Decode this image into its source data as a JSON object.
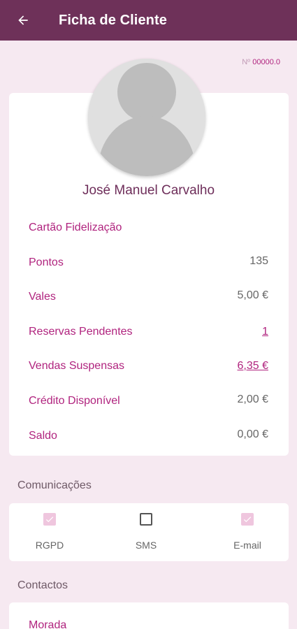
{
  "appbar": {
    "title": "Ficha de Cliente",
    "back_icon": "arrow-left-icon",
    "background": "#6e3159"
  },
  "client": {
    "number_prefix": "Nº",
    "number": "00000.0",
    "name": "José Manuel Carvalho",
    "avatar_icon": "person-placeholder-icon"
  },
  "info": {
    "loyalty_card_label": "Cartão Fidelização",
    "rows": [
      {
        "label": "Pontos",
        "value": "135"
      },
      {
        "label": "Vales",
        "value": "5,00 €"
      },
      {
        "label": "Reservas Pendentes",
        "value": "1"
      },
      {
        "label": "Vendas Suspensas",
        "value": "6,35 €"
      },
      {
        "label": "Crédito Disponível",
        "value": "2,00 €"
      },
      {
        "label": "Saldo",
        "value": "0,00 €"
      }
    ]
  },
  "communications": {
    "title": "Comunicações",
    "items": [
      {
        "label": "RGPD",
        "checked": true
      },
      {
        "label": "SMS",
        "checked": false
      },
      {
        "label": "E-mail",
        "checked": true
      }
    ]
  },
  "contacts": {
    "title": "Contactos",
    "address_label": "Morada"
  },
  "colors": {
    "accent": "#b0237e",
    "page_background": "#f6e9f1",
    "name_color": "#6e2e5a"
  }
}
